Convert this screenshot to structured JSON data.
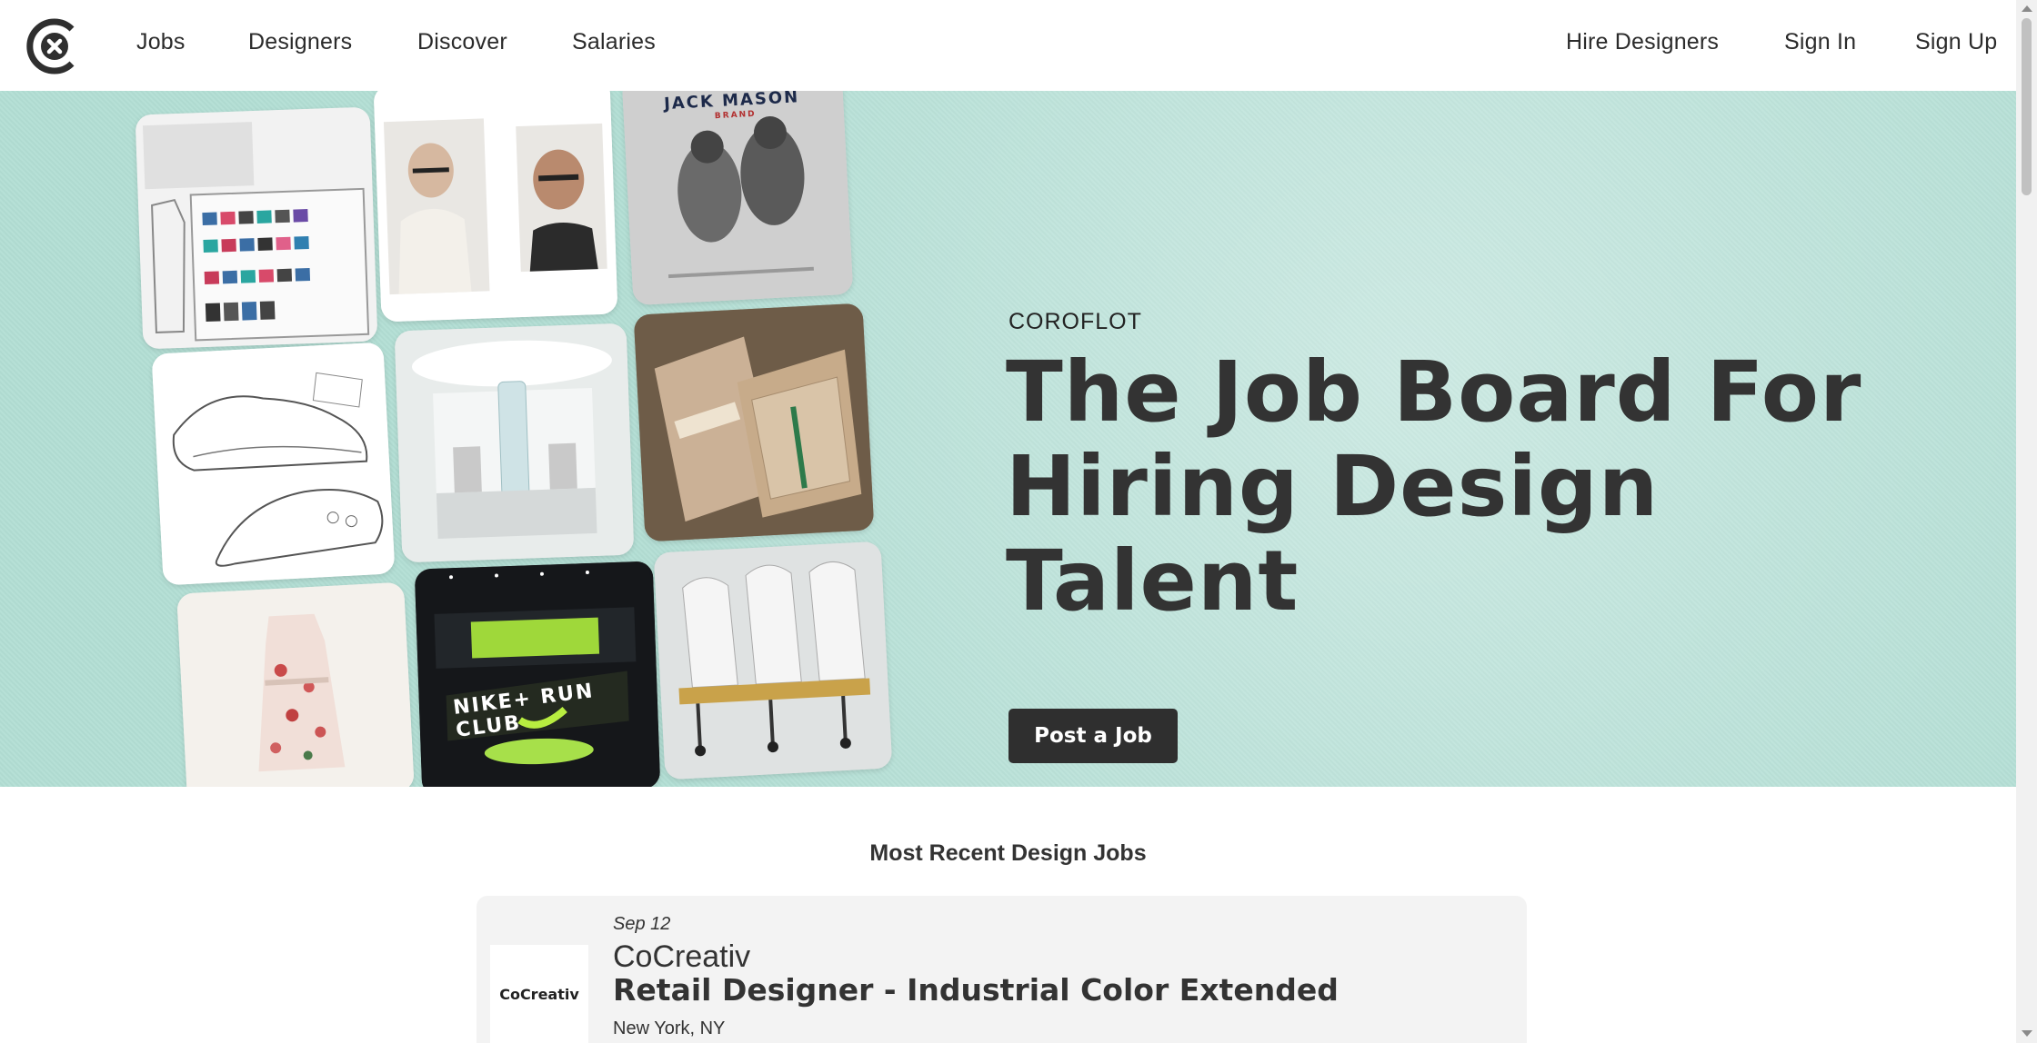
{
  "nav": {
    "logo_alt": "Coroflot logo",
    "left": [
      "Jobs",
      "Designers",
      "Discover",
      "Salaries"
    ],
    "right": [
      "Hire Designers",
      "Sign In",
      "Sign Up"
    ]
  },
  "hero": {
    "kicker": "COROFLOT",
    "title": "The Job Board For Hiring Design Talent",
    "cta": "Post a Job",
    "background_color": "#b2ded4",
    "tiles": {
      "jack_mason": "JACK MASON",
      "jack_mason_sub": "BRAND",
      "run_club": "NIKE+ RUN CLUB"
    }
  },
  "jobs": {
    "section_title": "Most Recent Design Jobs",
    "items": [
      {
        "date": "Sep 12",
        "company": "CoCreativ",
        "logo_text": "CoCreativ",
        "title": "Retail Designer - Industrial Color Extended",
        "location": "New York, NY"
      }
    ]
  }
}
